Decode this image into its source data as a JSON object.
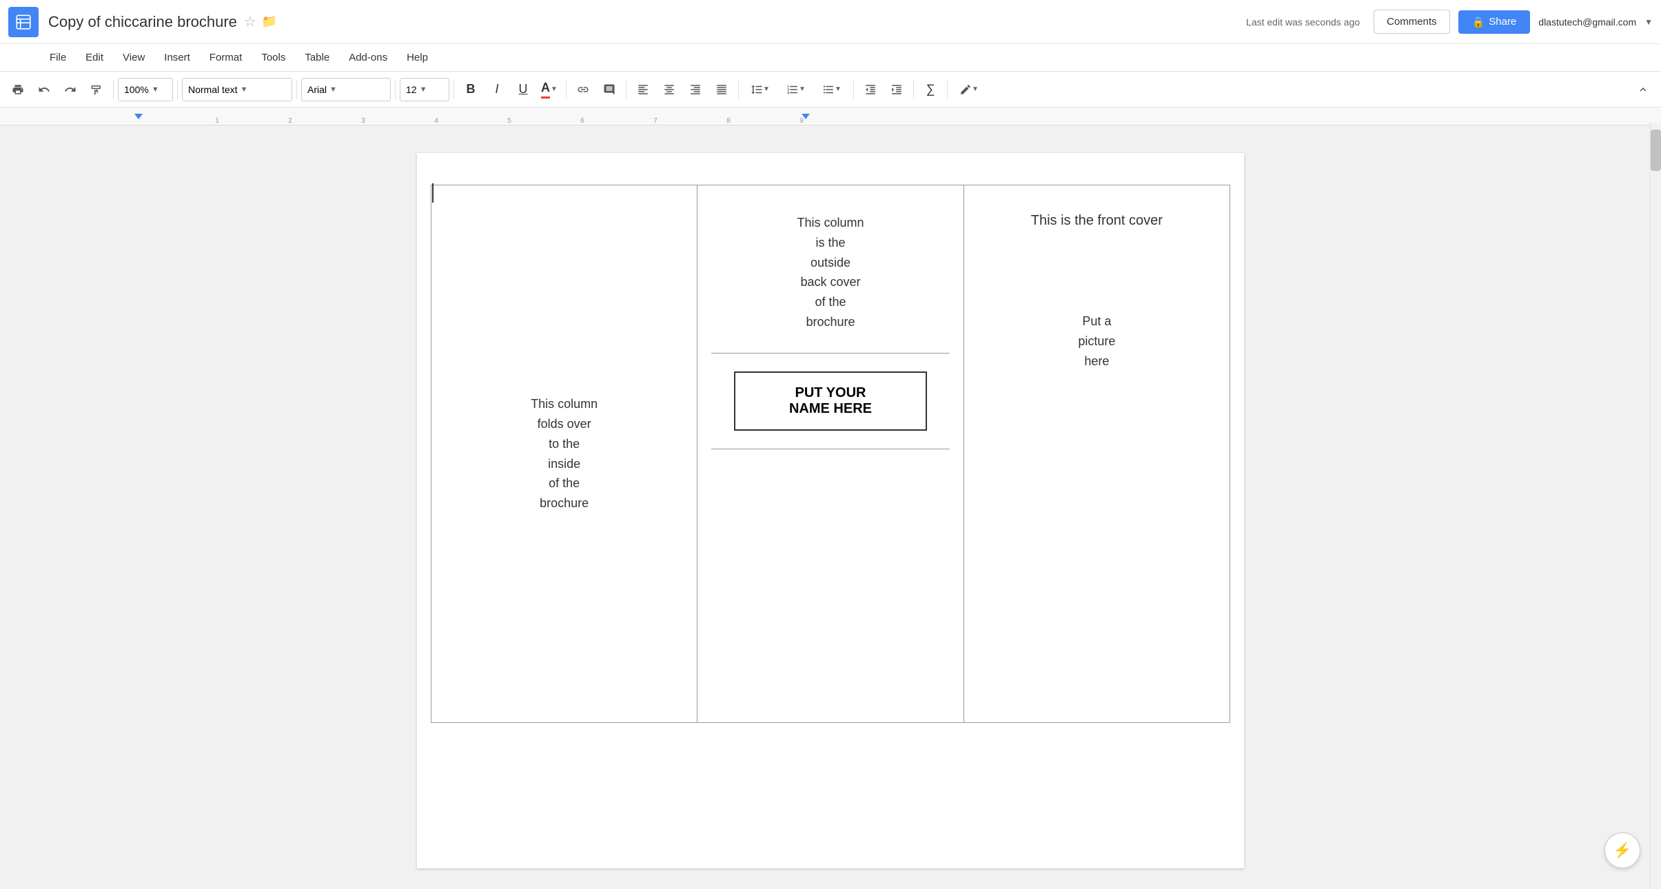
{
  "app": {
    "icon_color": "#4285F4",
    "title": "Copy of chiccarine brochure",
    "user_account": "dlastutech@gmail.com",
    "last_edit": "Last edit was seconds ago"
  },
  "header": {
    "comments_label": "Comments",
    "share_label": "Share"
  },
  "menu": {
    "items": [
      {
        "label": "File"
      },
      {
        "label": "Edit"
      },
      {
        "label": "View"
      },
      {
        "label": "Insert"
      },
      {
        "label": "Format"
      },
      {
        "label": "Tools"
      },
      {
        "label": "Table"
      },
      {
        "label": "Add-ons"
      },
      {
        "label": "Help"
      }
    ]
  },
  "toolbar": {
    "zoom": "100%",
    "style": "Normal text",
    "font": "Arial",
    "size": "12",
    "print_label": "🖨",
    "undo_label": "↩",
    "redo_label": "↪",
    "paint_label": "🎨",
    "bold_label": "B",
    "italic_label": "I",
    "underline_label": "U",
    "text_color_label": "A",
    "link_label": "🔗",
    "comment_label": "💬",
    "align_left": "≡",
    "align_center": "≡",
    "align_right": "≡",
    "align_justify": "≡",
    "line_spacing": "↕",
    "numbered_list": "1.",
    "bullet_list": "•",
    "indent_less": "←",
    "indent_more": "→",
    "formula": "∑"
  },
  "document": {
    "cursor_visible": true,
    "brochure": {
      "col1": {
        "text": "This column\nfolds over\nto the\ninside\nof the\nbrochure"
      },
      "col2": {
        "text_top": "This column\nis the\noutside\nback cover\nof the\nbrochure",
        "name_box_text": "PUT YOUR\nNAME HERE"
      },
      "col3": {
        "title": "This is the front cover",
        "picture_text": "Put a\npicture\nhere"
      }
    }
  },
  "smartcompose": {
    "icon": "⚡"
  }
}
